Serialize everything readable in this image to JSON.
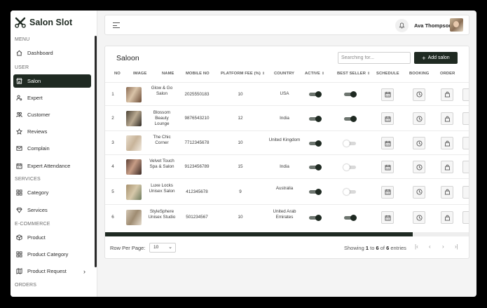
{
  "app": {
    "name": "Salon Slot"
  },
  "sidebar": {
    "sections": {
      "menu": "MENU",
      "user": "USER",
      "services": "SERVICES",
      "ecommerce": "E-COMMERCE",
      "orders": "ORDERS"
    },
    "items": [
      {
        "label": "Dashboard",
        "icon": "home-icon"
      },
      {
        "label": "Salon",
        "icon": "storefront-icon",
        "active": true
      },
      {
        "label": "Expert",
        "icon": "user-gear-icon"
      },
      {
        "label": "Customer",
        "icon": "users-icon"
      },
      {
        "label": "Reviews",
        "icon": "star-icon"
      },
      {
        "label": "Complain",
        "icon": "mail-icon"
      },
      {
        "label": "Expert Attendance",
        "icon": "calendar-icon"
      },
      {
        "label": "Category",
        "icon": "grid-icon"
      },
      {
        "label": "Services",
        "icon": "diamond-icon"
      },
      {
        "label": "Product",
        "icon": "box-icon"
      },
      {
        "label": "Product Category",
        "icon": "grid-icon"
      },
      {
        "label": "Product Request",
        "icon": "map-icon",
        "chevron": "›"
      }
    ]
  },
  "header": {
    "user_name": "Ava Thompson"
  },
  "card": {
    "title": "Saloon",
    "search_placeholder": "Searching for...",
    "add_button": "Add salon",
    "columns": [
      "NO",
      "IMAGE",
      "NAME",
      "MOBILE NO",
      "PLATFORM FEE (%)",
      "COUNTRY",
      "ACTIVE",
      "BEST SELLER",
      "SCHEDULE",
      "BOOKING",
      "ORDER"
    ],
    "sort_glyph": "⇕",
    "rows": [
      {
        "no": "1",
        "name": "Glow & Go Salon",
        "mobile": "2025550183",
        "fee": "10",
        "country": "USA",
        "active": true,
        "best_seller": true
      },
      {
        "no": "2",
        "name": "Blossom Beauty Lounge",
        "mobile": "9876543210",
        "fee": "12",
        "country": "India",
        "active": true,
        "best_seller": true
      },
      {
        "no": "3",
        "name": "The Chic Corner",
        "mobile": "7712345678",
        "fee": "10",
        "country": "United Kingdom",
        "active": true,
        "best_seller": false
      },
      {
        "no": "4",
        "name": "Velvet Touch Spa & Salon",
        "mobile": "9123456789",
        "fee": "15",
        "country": "India",
        "active": true,
        "best_seller": false
      },
      {
        "no": "5",
        "name": "Luxe Locks Unisex Salon",
        "mobile": "412345678",
        "fee": "9",
        "country": "Australia",
        "active": true,
        "best_seller": false
      },
      {
        "no": "6",
        "name": "StyleSphere Unisex Studio",
        "mobile": "501234567",
        "fee": "10",
        "country": "United Arab Emirates",
        "active": true,
        "best_seller": true
      }
    ],
    "footer": {
      "rows_per_page_label": "Row Per Page:",
      "rows_per_page_value": "10",
      "showing_prefix": "Showing",
      "from": "1",
      "to_word": "to",
      "to": "6",
      "of_word": "of",
      "total": "6",
      "suffix": "entries"
    }
  },
  "colors": {
    "brand": "#1f2a22",
    "toggle_on_track": "#6d756f",
    "toggle_off_track": "#d9d9d9"
  }
}
